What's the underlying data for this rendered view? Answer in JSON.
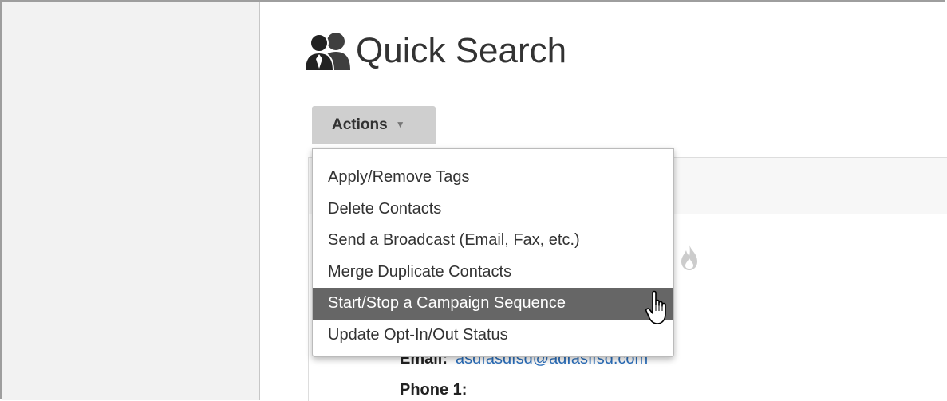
{
  "page": {
    "title": "Quick Search",
    "title_icon": "contacts-icon"
  },
  "actions": {
    "label": "Actions",
    "caret_icon": "caret-down-icon",
    "menu": [
      {
        "label": "Apply/Remove Tags",
        "active": false
      },
      {
        "label": "Delete Contacts",
        "active": false
      },
      {
        "label": "Send a Broadcast (Email, Fax, etc.)",
        "active": false
      },
      {
        "label": "Merge Duplicate Contacts",
        "active": false
      },
      {
        "label": "Start/Stop a Campaign Sequence",
        "active": true
      },
      {
        "label": "Update Opt-In/Out Status",
        "active": false
      }
    ]
  },
  "contact": {
    "email_label": "Email:",
    "email_value": "asdfasdfsd@adfasffsd.com",
    "phone_label": "Phone 1:"
  },
  "colors": {
    "highlight": "#666666",
    "link": "#2a6ebb",
    "button_bg": "#cfcfcf"
  }
}
